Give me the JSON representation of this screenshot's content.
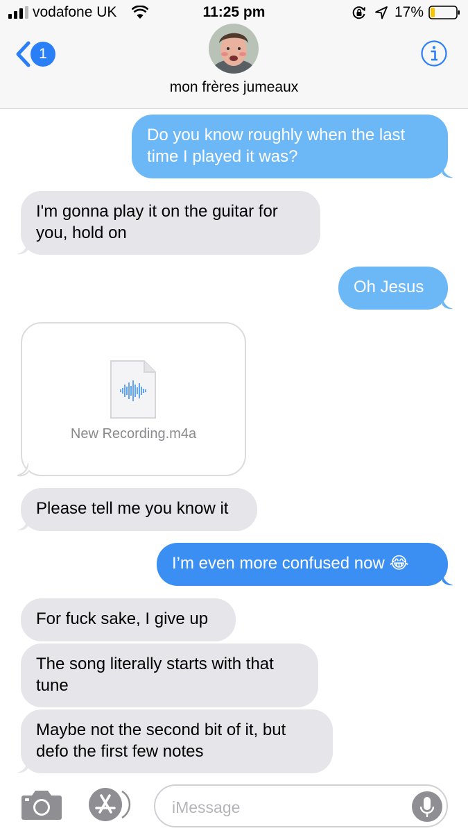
{
  "status_bar": {
    "carrier": "vodafone UK",
    "time": "11:25 pm",
    "battery_percent": "17%",
    "battery_level": 0.17,
    "icons": [
      "signal-icon",
      "wifi-icon",
      "orientation-lock-icon",
      "location-icon",
      "battery-icon"
    ]
  },
  "header": {
    "back_badge_count": "1",
    "contact_name": "mon frères jumeaux",
    "back_icon": "chevron-left-icon",
    "info_icon": "info-icon"
  },
  "messages": [
    {
      "sender": "me",
      "text": "Do you know roughly when the last time I played it was?"
    },
    {
      "sender": "them",
      "text": "I'm gonna play it on the guitar for you, hold on"
    },
    {
      "sender": "me",
      "text": "Oh Jesus"
    },
    {
      "sender": "them",
      "type": "attachment",
      "file_name": "New Recording.m4a",
      "icon": "audio-file-icon"
    },
    {
      "sender": "them",
      "text": "Please tell me you know it"
    },
    {
      "sender": "me",
      "text": "I’m even more confused now 😂"
    },
    {
      "sender": "them",
      "text": "For fuck sake, I give up"
    },
    {
      "sender": "them",
      "text": "The song literally starts with that tune"
    },
    {
      "sender": "them",
      "text": "Maybe not the second bit of it, but defo the first few notes"
    }
  ],
  "input_bar": {
    "placeholder": "iMessage",
    "value": "",
    "icons": [
      "camera-icon",
      "app-store-icon",
      "microphone-icon"
    ]
  },
  "colors": {
    "incoming_bubble": "#e5e5ea",
    "outgoing_bubble": "#3b8ff3",
    "outgoing_bubble_light": "#6cb8f7",
    "accent": "#2a7ef6"
  }
}
